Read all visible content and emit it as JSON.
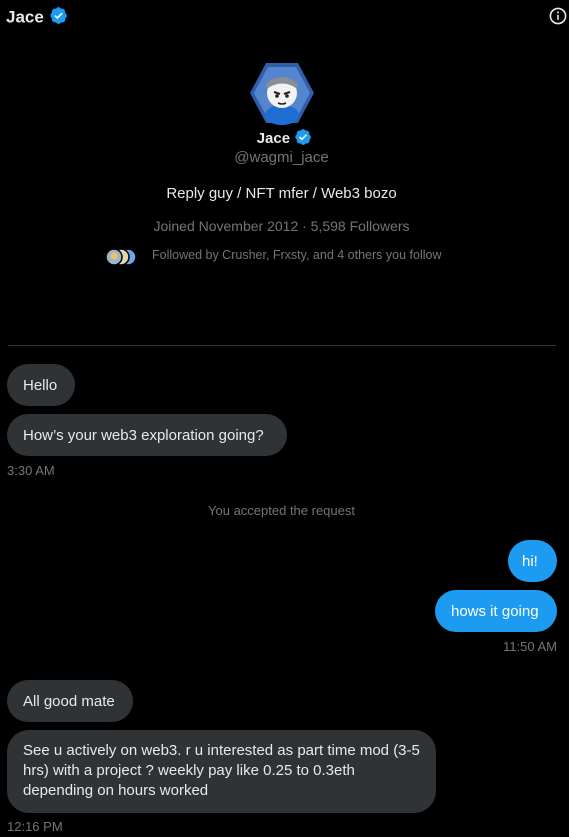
{
  "header": {
    "name": "Jace"
  },
  "profile": {
    "name": "Jace",
    "handle": "@wagmi_jace",
    "bio": "Reply guy / NFT mfer / Web3 bozo",
    "joined": "Joined November 2012 · 5,598 Followers",
    "followed_by": "Followed by Crusher, Frxsty, and 4 others you follow"
  },
  "messages": {
    "m1": "Hello",
    "m2": "How’s your web3 exploration going?",
    "t1": "3:30 AM",
    "system": "You accepted the request",
    "m3": "hi!",
    "m4": "hows it going",
    "t2": "11:50 AM",
    "m5": "All good mate",
    "m6": "See u actively on web3.  r u interested as part time mod (3-5 hrs) with a project ? weekly pay like 0.25 to 0.3eth depending on hours worked",
    "t3": "12:16 PM"
  },
  "colors": {
    "accent": "#1d9bf0",
    "bubble_received": "#2f3336",
    "muted": "#71767b"
  },
  "icons": {
    "verified": "verified-badge-icon",
    "info": "info-icon"
  }
}
